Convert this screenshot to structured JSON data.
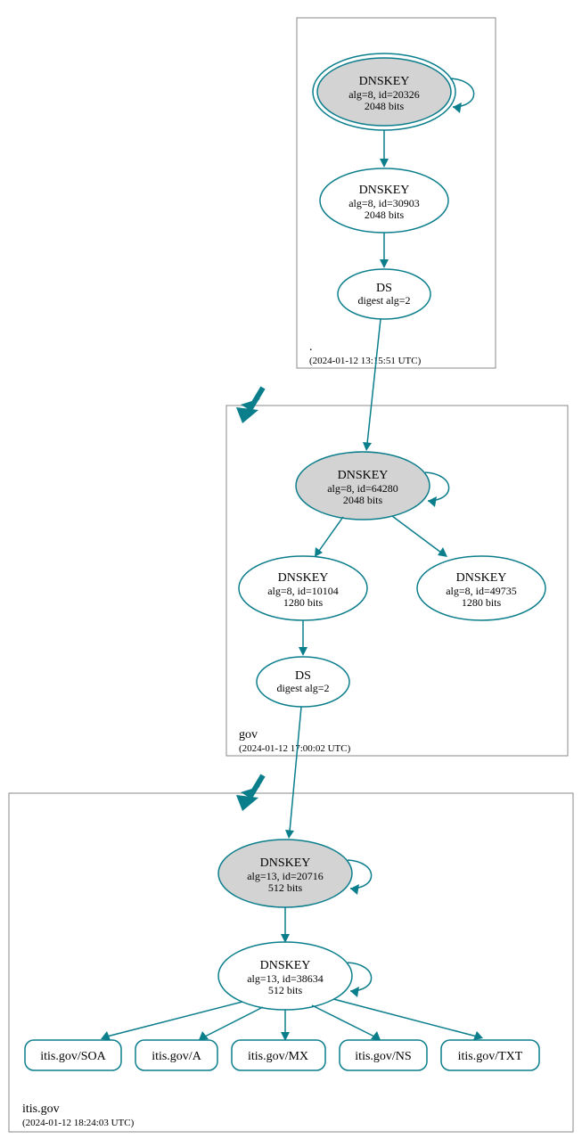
{
  "chart_data": {
    "type": "dnssec-chain",
    "zones": [
      {
        "name": ".",
        "timestamp": "(2024-01-12 13:15:51 UTC)",
        "nodes": [
          {
            "id": "root-ksk",
            "type": "DNSKEY",
            "lines": [
              "alg=8, id=20326",
              "2048 bits"
            ],
            "ksk": true,
            "selfloop": true
          },
          {
            "id": "root-zsk",
            "type": "DNSKEY",
            "lines": [
              "alg=8, id=30903",
              "2048 bits"
            ]
          },
          {
            "id": "root-ds",
            "type": "DS",
            "lines": [
              "digest alg=2"
            ]
          }
        ]
      },
      {
        "name": "gov",
        "timestamp": "(2024-01-12 17:00:02 UTC)",
        "nodes": [
          {
            "id": "gov-ksk",
            "type": "DNSKEY",
            "lines": [
              "alg=8, id=64280",
              "2048 bits"
            ],
            "ksk": true,
            "selfloop": true
          },
          {
            "id": "gov-zsk",
            "type": "DNSKEY",
            "lines": [
              "alg=8, id=10104",
              "1280 bits"
            ]
          },
          {
            "id": "gov-zsk2",
            "type": "DNSKEY",
            "lines": [
              "alg=8, id=49735",
              "1280 bits"
            ]
          },
          {
            "id": "gov-ds",
            "type": "DS",
            "lines": [
              "digest alg=2"
            ]
          }
        ]
      },
      {
        "name": "itis.gov",
        "timestamp": "(2024-01-12 18:24:03 UTC)",
        "nodes": [
          {
            "id": "itis-ksk",
            "type": "DNSKEY",
            "lines": [
              "alg=13, id=20716",
              "512 bits"
            ],
            "ksk": true,
            "selfloop": true
          },
          {
            "id": "itis-zsk",
            "type": "DNSKEY",
            "lines": [
              "alg=13, id=38634",
              "512 bits"
            ],
            "selfloop": true
          }
        ],
        "rrsets": [
          "itis.gov/SOA",
          "itis.gov/A",
          "itis.gov/MX",
          "itis.gov/NS",
          "itis.gov/TXT"
        ]
      }
    ],
    "edges": [
      [
        "root-ksk",
        "root-zsk"
      ],
      [
        "root-zsk",
        "root-ds"
      ],
      [
        "root-ds",
        "gov-ksk"
      ],
      [
        "gov-ksk",
        "gov-zsk"
      ],
      [
        "gov-ksk",
        "gov-zsk2"
      ],
      [
        "gov-zsk",
        "gov-ds"
      ],
      [
        "gov-ds",
        "itis-ksk"
      ],
      [
        "itis-ksk",
        "itis-zsk"
      ],
      [
        "itis-zsk",
        "itis.gov/SOA"
      ],
      [
        "itis-zsk",
        "itis.gov/A"
      ],
      [
        "itis-zsk",
        "itis.gov/MX"
      ],
      [
        "itis-zsk",
        "itis.gov/NS"
      ],
      [
        "itis-zsk",
        "itis.gov/TXT"
      ]
    ]
  },
  "zone_root_name": ".",
  "zone_root_ts": "(2024-01-12 13:15:51 UTC)",
  "zone_gov_name": "gov",
  "zone_gov_ts": "(2024-01-12 17:00:02 UTC)",
  "zone_itis_name": "itis.gov",
  "zone_itis_ts": "(2024-01-12 18:24:03 UTC)",
  "root_ksk_t": "DNSKEY",
  "root_ksk_l1": "alg=8, id=20326",
  "root_ksk_l2": "2048 bits",
  "root_zsk_t": "DNSKEY",
  "root_zsk_l1": "alg=8, id=30903",
  "root_zsk_l2": "2048 bits",
  "root_ds_t": "DS",
  "root_ds_l1": "digest alg=2",
  "gov_ksk_t": "DNSKEY",
  "gov_ksk_l1": "alg=8, id=64280",
  "gov_ksk_l2": "2048 bits",
  "gov_zsk_t": "DNSKEY",
  "gov_zsk_l1": "alg=8, id=10104",
  "gov_zsk_l2": "1280 bits",
  "gov_zsk2_t": "DNSKEY",
  "gov_zsk2_l1": "alg=8, id=49735",
  "gov_zsk2_l2": "1280 bits",
  "gov_ds_t": "DS",
  "gov_ds_l1": "digest alg=2",
  "itis_ksk_t": "DNSKEY",
  "itis_ksk_l1": "alg=13, id=20716",
  "itis_ksk_l2": "512 bits",
  "itis_zsk_t": "DNSKEY",
  "itis_zsk_l1": "alg=13, id=38634",
  "itis_zsk_l2": "512 bits",
  "rr_soa": "itis.gov/SOA",
  "rr_a": "itis.gov/A",
  "rr_mx": "itis.gov/MX",
  "rr_ns": "itis.gov/NS",
  "rr_txt": "itis.gov/TXT"
}
